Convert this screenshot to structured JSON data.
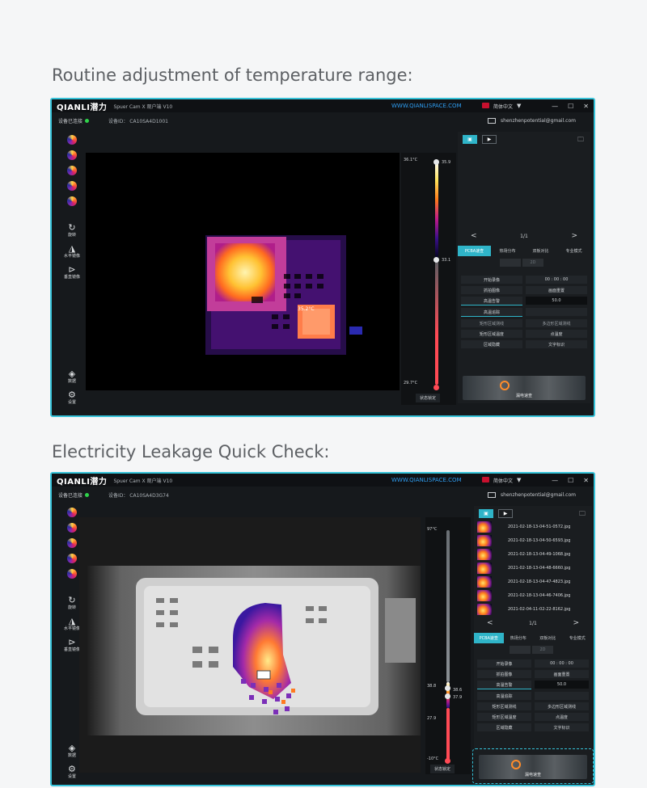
{
  "sections": [
    {
      "caption": "Routine adjustment of temperature range:",
      "app": {
        "logo": "QIANLI潜力",
        "appname": "Spuer Cam X 观户端 V10",
        "url": "WWW.QIANLISPACE.COM",
        "language": "简体中文",
        "win_min": "—",
        "win_max": "☐",
        "win_close": "✕",
        "connected": "设备已连接",
        "device_id": "设备ID：  CA10SA4D1001",
        "email": "shenzhenpotential@gmail.com"
      },
      "tools": [
        {
          "label": "旋转",
          "icon": "↻"
        },
        {
          "label": "水平镜像",
          "icon": "◮"
        },
        {
          "label": "垂直镜像",
          "icon": "⊳"
        }
      ],
      "bottom_tools": [
        {
          "label": "数据",
          "icon": "◈"
        },
        {
          "label": "设置",
          "icon": "⚙"
        }
      ],
      "hotspot_label": "35.2°C",
      "scale": {
        "top": "36.1°C",
        "bottom": "29.7°C",
        "upper_knob": "35.9",
        "lower_knob": "33.1",
        "lock_button": "状态锁定"
      },
      "right": {
        "page": "1/1",
        "mode_tabs": [
          "PCBA速查",
          "热场分布",
          "双板对比",
          "专业模式"
        ],
        "seg": [
          "",
          "2D"
        ],
        "rows": [
          [
            {
              "t": "开始录像"
            },
            {
              "t": "00 : 00 : 00"
            }
          ],
          [
            {
              "t": "抓拍图像"
            },
            {
              "t": "画面重置"
            }
          ],
          [
            {
              "t": "高温告警",
              "sel": true
            },
            {
              "t": "50.0",
              "val": true
            }
          ],
          [
            {
              "t": "高温追踪",
              "sel": true
            },
            {
              "t": ""
            }
          ],
          [
            {
              "t": "矩形区域测线",
              "dim": true
            },
            {
              "t": "多边形区域测线",
              "dim": true
            }
          ],
          [
            {
              "t": "矩形区域温度"
            },
            {
              "t": "点温度"
            }
          ],
          [
            {
              "t": "区域隐藏"
            },
            {
              "t": "文字标识"
            }
          ]
        ],
        "banner_label": "漏电速查"
      }
    },
    {
      "caption": "Electricity Leakage Quick Check:",
      "app": {
        "logo": "QIANLI潜力",
        "appname": "Spuer Cam X 观户端 V10",
        "url": "WWW.QIANLISPACE.COM",
        "language": "简体中文",
        "win_min": "—",
        "win_max": "☐",
        "win_close": "✕",
        "connected": "设备已连接",
        "device_id": "设备ID：  CA10SA4D3G74",
        "email": "shenzhenpotential@gmail.com"
      },
      "tools": [
        {
          "label": "旋转",
          "icon": "↻"
        },
        {
          "label": "水平镜像",
          "icon": "◮"
        },
        {
          "label": "垂直镜像",
          "icon": "⊳"
        }
      ],
      "bottom_tools": [
        {
          "label": "数据",
          "icon": "◈"
        },
        {
          "label": "设置",
          "icon": "⚙"
        }
      ],
      "scale": {
        "top": "97°C",
        "mid_upper": "38.8",
        "mid_lower": "27.9",
        "bottom": "-10°C",
        "upper_knob": "38.6",
        "lower_knob": "37.9",
        "lock_button": "状态锁定"
      },
      "right": {
        "files": [
          "2021-02-18-13-04-51-0572.jpg",
          "2021-02-18-13-04-50-6593.jpg",
          "2021-02-18-13-04-49-1068.jpg",
          "2021-02-18-13-04-48-6660.jpg",
          "2021-02-18-13-04-47-4823.jpg",
          "2021-02-18-13-04-46-7406.jpg",
          "2021-02-04-11-02-22-8162.jpg"
        ],
        "page": "1/1",
        "mode_tabs": [
          "PCBA速查",
          "热场分布",
          "双板对比",
          "专业模式"
        ],
        "seg": [
          "",
          "2D"
        ],
        "rows": [
          [
            {
              "t": "开始录像"
            },
            {
              "t": "00 : 00 : 00"
            }
          ],
          [
            {
              "t": "抓拍图像"
            },
            {
              "t": "画面重置"
            }
          ],
          [
            {
              "t": "高温告警",
              "sel": true
            },
            {
              "t": "50.0",
              "val": true
            }
          ],
          [
            {
              "t": "高温追踪"
            },
            {
              "t": ""
            }
          ],
          [
            {
              "t": "矩形区域测线"
            },
            {
              "t": "多边形区域测线"
            }
          ],
          [
            {
              "t": "矩形区域温度"
            },
            {
              "t": "点温度"
            }
          ],
          [
            {
              "t": "区域隐藏"
            },
            {
              "t": "文字标识"
            }
          ]
        ],
        "banner_label": "漏电速查"
      }
    }
  ]
}
